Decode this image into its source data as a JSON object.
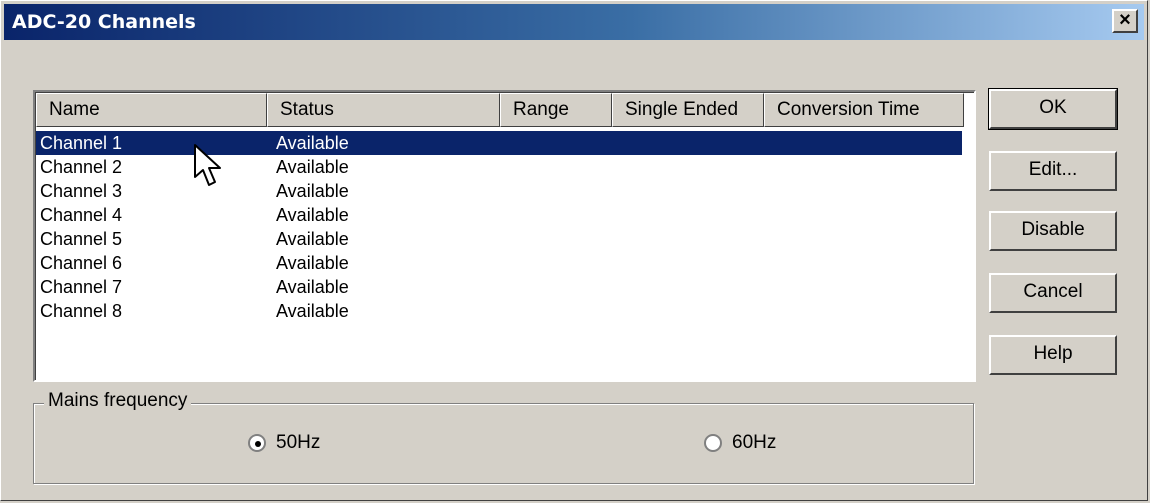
{
  "window": {
    "title": "ADC-20 Channels",
    "close_glyph": "×"
  },
  "table": {
    "columns": [
      "Name",
      "Status",
      "Range",
      "Single Ended",
      "Conversion Time"
    ],
    "rows": [
      {
        "name": "Channel 1",
        "status": "Available",
        "selected": true
      },
      {
        "name": "Channel 2",
        "status": "Available"
      },
      {
        "name": "Channel 3",
        "status": "Available"
      },
      {
        "name": "Channel 4",
        "status": "Available"
      },
      {
        "name": "Channel 5",
        "status": "Available"
      },
      {
        "name": "Channel 6",
        "status": "Available"
      },
      {
        "name": "Channel 7",
        "status": "Available"
      },
      {
        "name": "Channel 8",
        "status": "Available"
      }
    ]
  },
  "buttons": {
    "ok": "OK",
    "edit": "Edit...",
    "disable": "Disable",
    "cancel": "Cancel",
    "help": "Help"
  },
  "mains": {
    "label": "Mains frequency",
    "options": [
      {
        "label": "50Hz",
        "selected": true
      },
      {
        "label": "60Hz",
        "selected": false
      }
    ]
  },
  "colors": {
    "selection": "#0a246a",
    "title_start": "#0a246a",
    "title_end": "#a6caf0",
    "face": "#d4d0c8"
  },
  "icons": {
    "close": "close-icon",
    "cursor": "mouse-pointer-icon"
  }
}
